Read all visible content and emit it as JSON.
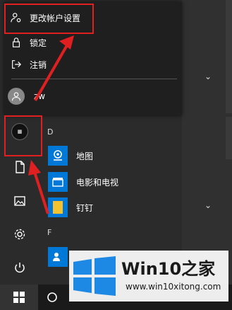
{
  "popup": {
    "items": [
      {
        "label": "更改帐户设置",
        "icon": "user-settings-icon"
      },
      {
        "label": "锁定",
        "icon": "lock-icon"
      },
      {
        "label": "注销",
        "icon": "sign-out-icon"
      }
    ],
    "user": {
      "name": "zw",
      "icon": "avatar-icon"
    }
  },
  "sections": {
    "d": "D",
    "f": "F"
  },
  "apps": [
    {
      "name": "地图",
      "icon": "maps-icon"
    },
    {
      "name": "电影和电视",
      "icon": "movies-tv-icon"
    },
    {
      "name": "钉钉",
      "icon": "dingtalk-icon"
    }
  ],
  "watermark": {
    "title": "Win10之家",
    "url": "www.win10xitong.com"
  },
  "colors": {
    "accent": "#0078d7",
    "highlight": "#e02020",
    "menu_bg": "#2b2b2b"
  }
}
